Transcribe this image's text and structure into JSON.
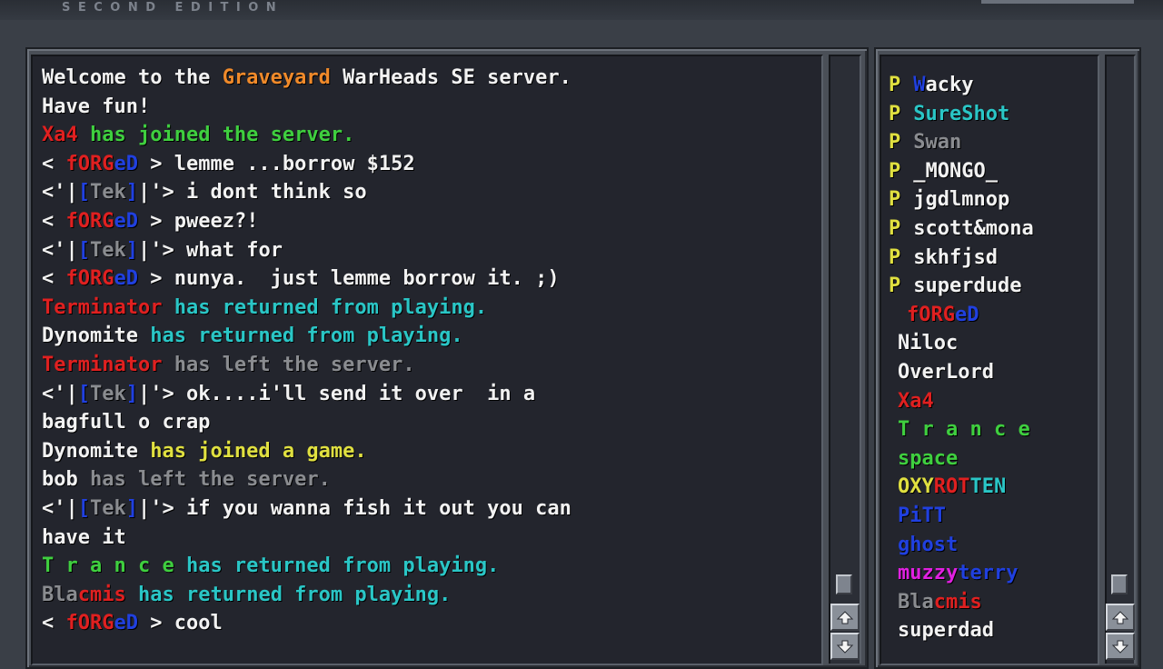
{
  "header": {
    "edition": "SECOND EDITION"
  },
  "colors": {
    "default": "#f2f2f2",
    "orange": "#f08a2a",
    "green": "#3fcf3f",
    "red": "#e02020",
    "blue": "#2040e0",
    "cyan": "#2ac6c6",
    "gray": "#8a8c90",
    "yellow": "#e0e040",
    "magenta": "#e020e0"
  },
  "chat": {
    "lines": [
      [
        {
          "t": "Welcome to the ",
          "c": "default"
        },
        {
          "t": "Graveyard",
          "c": "orange"
        },
        {
          "t": " WarHeads SE server.",
          "c": "default"
        }
      ],
      [
        {
          "t": "Have fun!",
          "c": "default"
        }
      ],
      [
        {
          "t": "Xa4",
          "c": "red"
        },
        {
          "t": " has joined the server.",
          "c": "green"
        }
      ],
      [
        {
          "t": "< ",
          "c": "default"
        },
        {
          "t": "fORG",
          "c": "red"
        },
        {
          "t": "eD",
          "c": "blue"
        },
        {
          "t": " > lemme ...borrow $152",
          "c": "default"
        }
      ],
      [
        {
          "t": "<'|",
          "c": "default"
        },
        {
          "t": "[",
          "c": "blue"
        },
        {
          "t": "Tek",
          "c": "gray"
        },
        {
          "t": "]",
          "c": "blue"
        },
        {
          "t": "|'> i dont think so",
          "c": "default"
        }
      ],
      [
        {
          "t": "< ",
          "c": "default"
        },
        {
          "t": "fORG",
          "c": "red"
        },
        {
          "t": "eD",
          "c": "blue"
        },
        {
          "t": " > pweez?!",
          "c": "default"
        }
      ],
      [
        {
          "t": "<'|",
          "c": "default"
        },
        {
          "t": "[",
          "c": "blue"
        },
        {
          "t": "Tek",
          "c": "gray"
        },
        {
          "t": "]",
          "c": "blue"
        },
        {
          "t": "|'> what for",
          "c": "default"
        }
      ],
      [
        {
          "t": "< ",
          "c": "default"
        },
        {
          "t": "fORG",
          "c": "red"
        },
        {
          "t": "eD",
          "c": "blue"
        },
        {
          "t": " > nunya.  just lemme borrow it. ;)",
          "c": "default"
        }
      ],
      [
        {
          "t": "Terminator",
          "c": "red"
        },
        {
          "t": " has returned from playing.",
          "c": "cyan"
        }
      ],
      [
        {
          "t": "Dynomite",
          "c": "default"
        },
        {
          "t": " has returned from playing.",
          "c": "cyan"
        }
      ],
      [
        {
          "t": "Terminator",
          "c": "red"
        },
        {
          "t": " has left the server.",
          "c": "gray"
        }
      ],
      [
        {
          "t": "<'|",
          "c": "default"
        },
        {
          "t": "[",
          "c": "blue"
        },
        {
          "t": "Tek",
          "c": "gray"
        },
        {
          "t": "]",
          "c": "blue"
        },
        {
          "t": "|'> ok....i'll send it over  in a",
          "c": "default"
        }
      ],
      [
        {
          "t": "bagfull o crap",
          "c": "default"
        }
      ],
      [
        {
          "t": "Dynomite",
          "c": "default"
        },
        {
          "t": " has joined a game.",
          "c": "yellow"
        }
      ],
      [
        {
          "t": "bob",
          "c": "default"
        },
        {
          "t": " has left the server.",
          "c": "gray"
        }
      ],
      [
        {
          "t": "<'|",
          "c": "default"
        },
        {
          "t": "[",
          "c": "blue"
        },
        {
          "t": "Tek",
          "c": "gray"
        },
        {
          "t": "]",
          "c": "blue"
        },
        {
          "t": "|'> if you wanna fish it out you can",
          "c": "default"
        }
      ],
      [
        {
          "t": "have it",
          "c": "default"
        }
      ],
      [
        {
          "t": "T r a n c e",
          "c": "green"
        },
        {
          "t": " has returned from playing.",
          "c": "cyan"
        }
      ],
      [
        {
          "t": "Bla",
          "c": "gray"
        },
        {
          "t": "c",
          "c": "red"
        },
        {
          "t": "mis",
          "c": "red"
        },
        {
          "t": " has returned from playing.",
          "c": "cyan"
        }
      ],
      [
        {
          "t": "< ",
          "c": "default"
        },
        {
          "t": "fORG",
          "c": "red"
        },
        {
          "t": "eD",
          "c": "blue"
        },
        {
          "t": " > cool",
          "c": "default"
        }
      ]
    ]
  },
  "players": {
    "list": [
      {
        "p": "P",
        "segs": [
          {
            "t": "W",
            "c": "blue"
          },
          {
            "t": "acky",
            "c": "default"
          }
        ]
      },
      {
        "p": "P",
        "segs": [
          {
            "t": "SureShot",
            "c": "cyan"
          }
        ]
      },
      {
        "p": "P",
        "segs": [
          {
            "t": "Swan",
            "c": "gray"
          }
        ]
      },
      {
        "p": "P",
        "segs": [
          {
            "t": "_MONGO_",
            "c": "default"
          }
        ]
      },
      {
        "p": "P",
        "segs": [
          {
            "t": "jgdlmnop",
            "c": "default"
          }
        ]
      },
      {
        "p": "P",
        "segs": [
          {
            "t": "scott&mona",
            "c": "default"
          }
        ]
      },
      {
        "p": "P",
        "segs": [
          {
            "t": "skhfjsd",
            "c": "default"
          }
        ]
      },
      {
        "p": "P",
        "segs": [
          {
            "t": "superdude",
            "c": "default"
          }
        ]
      },
      {
        "p": "",
        "indent": 2,
        "segs": [
          {
            "t": "fORG",
            "c": "red"
          },
          {
            "t": "eD",
            "c": "blue"
          }
        ]
      },
      {
        "p": "",
        "indent": 1,
        "segs": [
          {
            "t": "Niloc",
            "c": "default"
          }
        ]
      },
      {
        "p": "",
        "indent": 1,
        "segs": [
          {
            "t": "OverLord",
            "c": "default"
          }
        ]
      },
      {
        "p": "",
        "indent": 1,
        "segs": [
          {
            "t": "Xa4",
            "c": "red"
          }
        ]
      },
      {
        "p": "",
        "indent": 1,
        "segs": [
          {
            "t": "T r a n c e",
            "c": "green"
          }
        ]
      },
      {
        "p": "",
        "indent": 1,
        "segs": [
          {
            "t": "space",
            "c": "green"
          }
        ]
      },
      {
        "p": "",
        "indent": 1,
        "segs": [
          {
            "t": "OXY",
            "c": "yellow"
          },
          {
            "t": "ROT",
            "c": "red"
          },
          {
            "t": "TEN",
            "c": "cyan"
          }
        ]
      },
      {
        "p": "",
        "indent": 1,
        "segs": [
          {
            "t": "PiTT",
            "c": "blue"
          }
        ]
      },
      {
        "p": "",
        "indent": 1,
        "segs": [
          {
            "t": "ghost",
            "c": "blue"
          }
        ]
      },
      {
        "p": "",
        "indent": 1,
        "segs": [
          {
            "t": "muzzy",
            "c": "magenta"
          },
          {
            "t": "terry",
            "c": "blue"
          }
        ]
      },
      {
        "p": "",
        "indent": 1,
        "segs": [
          {
            "t": "Bla",
            "c": "gray"
          },
          {
            "t": "cmis",
            "c": "red"
          }
        ]
      },
      {
        "p": "",
        "indent": 1,
        "segs": [
          {
            "t": "superdad",
            "c": "default"
          }
        ]
      }
    ]
  },
  "icons": {
    "scroll_up": "arrow-up-icon",
    "scroll_down": "arrow-down-icon"
  }
}
